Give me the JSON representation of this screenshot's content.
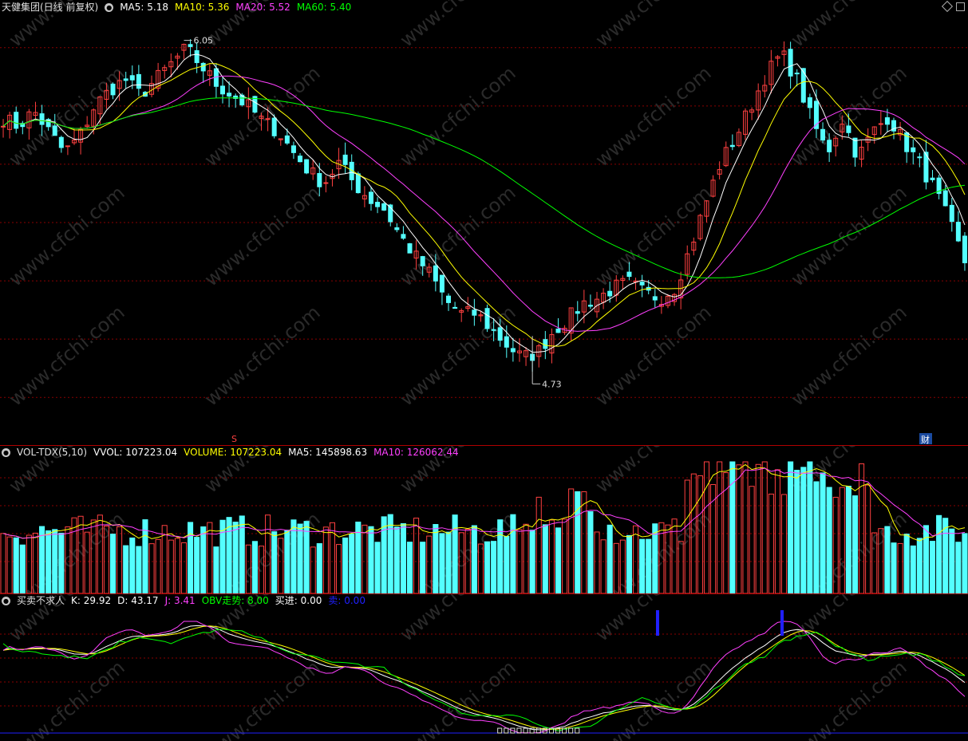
{
  "colors": {
    "up": "#ff4040",
    "down": "#54ffff",
    "ma5": "#ffffff",
    "ma10": "#ffff00",
    "ma20": "#ff40ff",
    "ma60": "#00ff00",
    "grid": "#8a0000",
    "blue": "#2020ff"
  },
  "price_panel": {
    "title": "天健集团(日线 前复权)",
    "ma_labels": [
      {
        "key": "ma5",
        "text": "MA5: 5.18"
      },
      {
        "key": "ma10",
        "text": "MA10: 5.36"
      },
      {
        "key": "ma20",
        "text": "MA20: 5.52"
      },
      {
        "key": "ma60",
        "text": "MA60: 5.40"
      }
    ],
    "high_label": "6.05",
    "low_label": "4.73",
    "marker_s": "S",
    "marker_cai": "财"
  },
  "volume_panel": {
    "title": "VOL-TDX(5,10)",
    "labels": [
      {
        "key": "ma5",
        "text": "VVOL: 107223.04"
      },
      {
        "key": "ma10",
        "text": "VOLUME: 107223.04"
      },
      {
        "key": "ma5",
        "text": "MA5: 145898.63"
      },
      {
        "key": "ma20",
        "text": "MA10: 126062.44"
      }
    ]
  },
  "indicator_panel": {
    "title": "买卖不求人",
    "labels": [
      {
        "key": "ma5",
        "text": "K: 29.92"
      },
      {
        "key": "ma5",
        "text": "D: 43.17"
      },
      {
        "key": "ma20",
        "text": "J: 3.41"
      },
      {
        "key": "ma60",
        "text": "OBV走势: 8.00"
      },
      {
        "key": "ma5",
        "text": "买进: 0.00"
      },
      {
        "key": "blue",
        "text": "卖: 0.00"
      }
    ]
  },
  "watermark": "www.cfchi.com",
  "chart_data": {
    "type": "candlestick",
    "ylim": [
      4.55,
      6.15
    ],
    "high": 6.05,
    "low": 4.73,
    "ma_values": {
      "MA5": 5.18,
      "MA10": 5.36,
      "MA20": 5.52,
      "MA60": 5.4
    },
    "close_path": [
      5.75,
      5.72,
      5.78,
      5.7,
      5.62,
      5.68,
      5.8,
      5.86,
      5.9,
      5.84,
      5.9,
      5.96,
      6.02,
      5.95,
      5.88,
      5.84,
      5.8,
      5.74,
      5.7,
      5.62,
      5.55,
      5.5,
      5.58,
      5.5,
      5.44,
      5.4,
      5.3,
      5.22,
      5.15,
      5.05,
      5.0,
      5.0,
      4.94,
      4.88,
      4.83,
      4.85,
      4.93,
      4.98,
      5.04,
      5.06,
      5.1,
      5.12,
      5.08,
      5.06,
      5.1,
      5.25,
      5.42,
      5.58,
      5.68,
      5.8,
      5.92,
      6.0,
      5.9,
      5.74,
      5.62,
      5.75,
      5.6,
      5.7,
      5.76,
      5.66,
      5.58,
      5.48,
      5.35,
      5.2
    ],
    "volume": {
      "latest": 107223.04,
      "ma5": 145898.63,
      "ma10": 126062.44
    },
    "kdj": {
      "K": 29.92,
      "D": 43.17,
      "J": 3.41,
      "OBV": 8.0,
      "buy": 0.0,
      "sell": 0.0
    }
  }
}
